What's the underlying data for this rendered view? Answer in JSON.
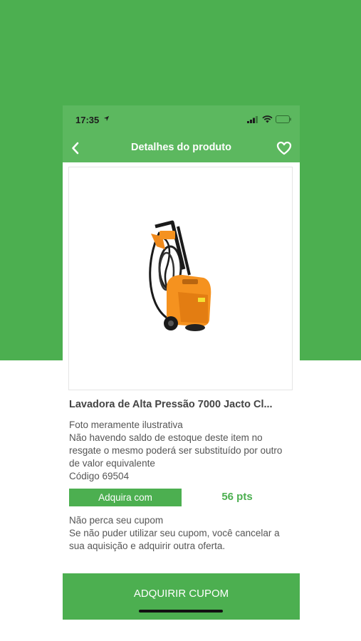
{
  "status_bar": {
    "time": "17:35"
  },
  "nav": {
    "title": "Detalhes do produto",
    "back_icon": "chevron-left-icon",
    "favorite_icon": "heart-outline-icon"
  },
  "product": {
    "name": "Lavadora de Alta Pressão 7000 Jacto Cl...",
    "image_icon": "pressure-washer-image",
    "description_lines": [
      "Foto meramente ilustrativa",
      "Não havendo saldo de estoque deste item no resgate o mesmo poderá ser substituído por outro de valor equivalente",
      "Código 69504"
    ]
  },
  "acquire": {
    "label": "Adquira com",
    "points": "56 pts"
  },
  "coupon": {
    "lines": [
      "Não perca seu cupom",
      "Se não puder utilizar seu cupom, você cancelar a sua aquisição e adquirir outra oferta."
    ]
  },
  "cta": {
    "label": "ADQUIRIR CUPOM"
  },
  "colors": {
    "primary_green": "#4caf50",
    "header_green": "#5cb85f",
    "text_gray": "#555555"
  }
}
